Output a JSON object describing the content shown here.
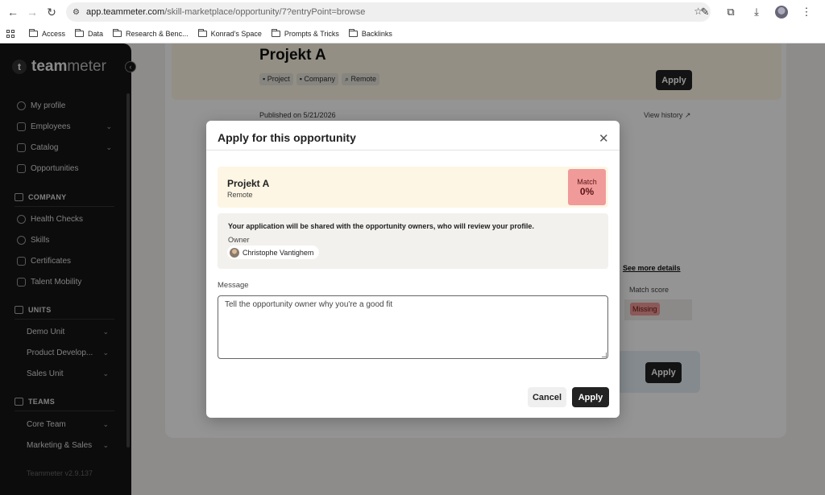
{
  "browser": {
    "url_host": "app.teammeter.com",
    "url_path": "/skill-marketplace/opportunity/7?entryPoint=browse",
    "bookmarks": [
      "Access",
      "Data",
      "Research & Benc...",
      "Konrad's Space",
      "Prompts & Tricks",
      "Backlinks"
    ]
  },
  "sidebar": {
    "logo_bold": "team",
    "logo_light": "meter",
    "items": [
      {
        "label": "My profile"
      },
      {
        "label": "Employees"
      },
      {
        "label": "Catalog"
      },
      {
        "label": "Opportunities"
      }
    ],
    "company_heading": "COMPANY",
    "company_items": [
      {
        "label": "Health Checks"
      },
      {
        "label": "Skills"
      },
      {
        "label": "Certificates"
      },
      {
        "label": "Talent Mobility"
      }
    ],
    "units_heading": "UNITS",
    "units": [
      {
        "label": "Demo Unit"
      },
      {
        "label": "Product Develop..."
      },
      {
        "label": "Sales Unit"
      }
    ],
    "teams_heading": "TEAMS",
    "teams": [
      {
        "label": "Core Team"
      },
      {
        "label": "Marketing & Sales"
      }
    ],
    "version": "Teammeter v2.9.137"
  },
  "page": {
    "title": "Projekt A",
    "tags": [
      "Project",
      "Company",
      "Remote"
    ],
    "apply_label": "Apply",
    "published": "Published on 5/21/2026",
    "view_history": "View history ↗",
    "see_more": "See more details",
    "match_score_label": "Match score",
    "missing_label": "Missing",
    "apply_bottom_label": "Apply"
  },
  "modal": {
    "title": "Apply for this opportunity",
    "opportunity_title": "Projekt A",
    "opportunity_location": "Remote",
    "match_label": "Match",
    "match_value": "0%",
    "info_text": "Your application will be shared with the opportunity owners, who will review your profile.",
    "owner_label": "Owner",
    "owner_name": "Christophe Vantighem",
    "message_label": "Message",
    "message_placeholder": "Tell the opportunity owner why you're a good fit",
    "cancel_label": "Cancel",
    "apply_label": "Apply"
  }
}
